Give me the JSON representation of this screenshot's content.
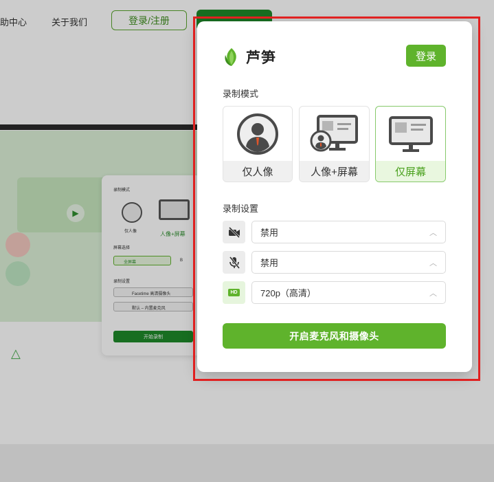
{
  "background": {
    "nav": {
      "help": "助中心",
      "about": "关于我们",
      "login_register": "登录/注册",
      "green_button": ""
    },
    "card": {
      "mode_label": "录制模式",
      "mode_portrait": "仅人像",
      "mode_portrait_screen": "人像+屏幕",
      "screen_label": "屏幕选择",
      "screen_value": "全屏幕",
      "screen_alt": "B",
      "settings_label": "录制设置",
      "camera_value": "Facetime 高清摄像头",
      "mic_value": "默认 – 内置麦克风",
      "start": "开始录制"
    }
  },
  "popup": {
    "brand": "芦笋",
    "login": "登录",
    "mode_title": "录制模式",
    "modes": [
      {
        "label": "仅人像",
        "icon": "portrait-icon",
        "selected": false
      },
      {
        "label": "人像+屏幕",
        "icon": "portrait-screen-icon",
        "selected": false
      },
      {
        "label": "仅屏幕",
        "icon": "screen-icon",
        "selected": true
      }
    ],
    "settings_title": "录制设置",
    "settings": [
      {
        "icon": "camera-off-icon",
        "value": "禁用"
      },
      {
        "icon": "mic-off-icon",
        "value": "禁用"
      },
      {
        "icon": "hd-icon",
        "icon_text": "HD",
        "value": "720p（高清）"
      }
    ],
    "start_button": "开启麦克风和摄像头"
  },
  "colors": {
    "accent": "#5fb32c",
    "selected_bg": "#e9f7df",
    "highlight_frame": "#e02020"
  }
}
